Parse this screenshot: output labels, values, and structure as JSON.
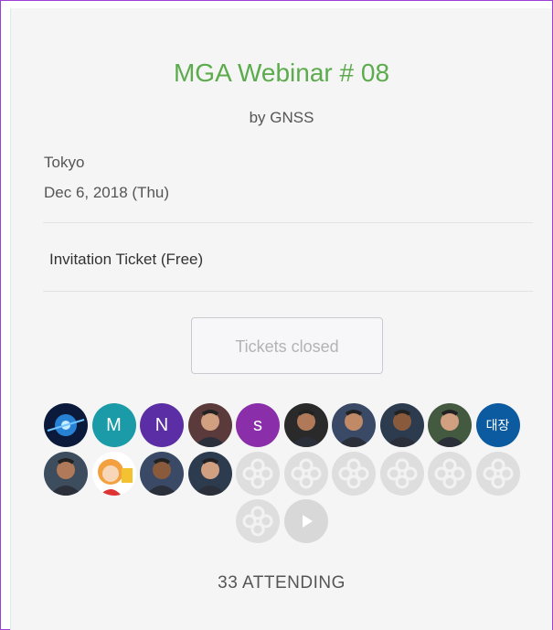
{
  "event": {
    "title": "MGA Webinar # 08",
    "organizer": "by GNSS",
    "location": "Tokyo",
    "date": "Dec 6, 2018 (Thu)"
  },
  "ticket": {
    "name": "Invitation Ticket (Free)",
    "button_label": "Tickets closed"
  },
  "attendees": {
    "count_label": "33 ATTENDING",
    "avatars": [
      {
        "type": "photo",
        "icon": "blue-space-photo"
      },
      {
        "type": "letter",
        "letter": "M",
        "color": "#1b9aa8"
      },
      {
        "type": "letter",
        "letter": "N",
        "color": "#5b2ea6"
      },
      {
        "type": "photo",
        "icon": "person-photo"
      },
      {
        "type": "letter",
        "letter": "s",
        "color": "#8a2eaa"
      },
      {
        "type": "photo",
        "icon": "person-photo"
      },
      {
        "type": "photo",
        "icon": "person-photo"
      },
      {
        "type": "photo",
        "icon": "person-photo"
      },
      {
        "type": "photo",
        "icon": "person-photo"
      },
      {
        "type": "letter",
        "letter": "대장",
        "color": "#0c5aa0"
      },
      {
        "type": "photo",
        "icon": "person-photo"
      },
      {
        "type": "photo",
        "icon": "cartoon-photo"
      },
      {
        "type": "photo",
        "icon": "person-photo"
      },
      {
        "type": "photo",
        "icon": "person-photo"
      },
      {
        "type": "placeholder",
        "icon": "placeholder-avatar-icon"
      },
      {
        "type": "placeholder",
        "icon": "placeholder-avatar-icon"
      },
      {
        "type": "placeholder",
        "icon": "placeholder-avatar-icon"
      },
      {
        "type": "placeholder",
        "icon": "placeholder-avatar-icon"
      },
      {
        "type": "placeholder",
        "icon": "placeholder-avatar-icon"
      },
      {
        "type": "placeholder",
        "icon": "placeholder-avatar-icon"
      },
      {
        "type": "placeholder",
        "icon": "placeholder-avatar-icon"
      },
      {
        "type": "more",
        "icon": "play-icon"
      }
    ]
  },
  "colors": {
    "title": "#5cab4d",
    "frame_border": "#9b3fd6",
    "card_bg": "#f5f5f5",
    "placeholder": "#dedede"
  }
}
